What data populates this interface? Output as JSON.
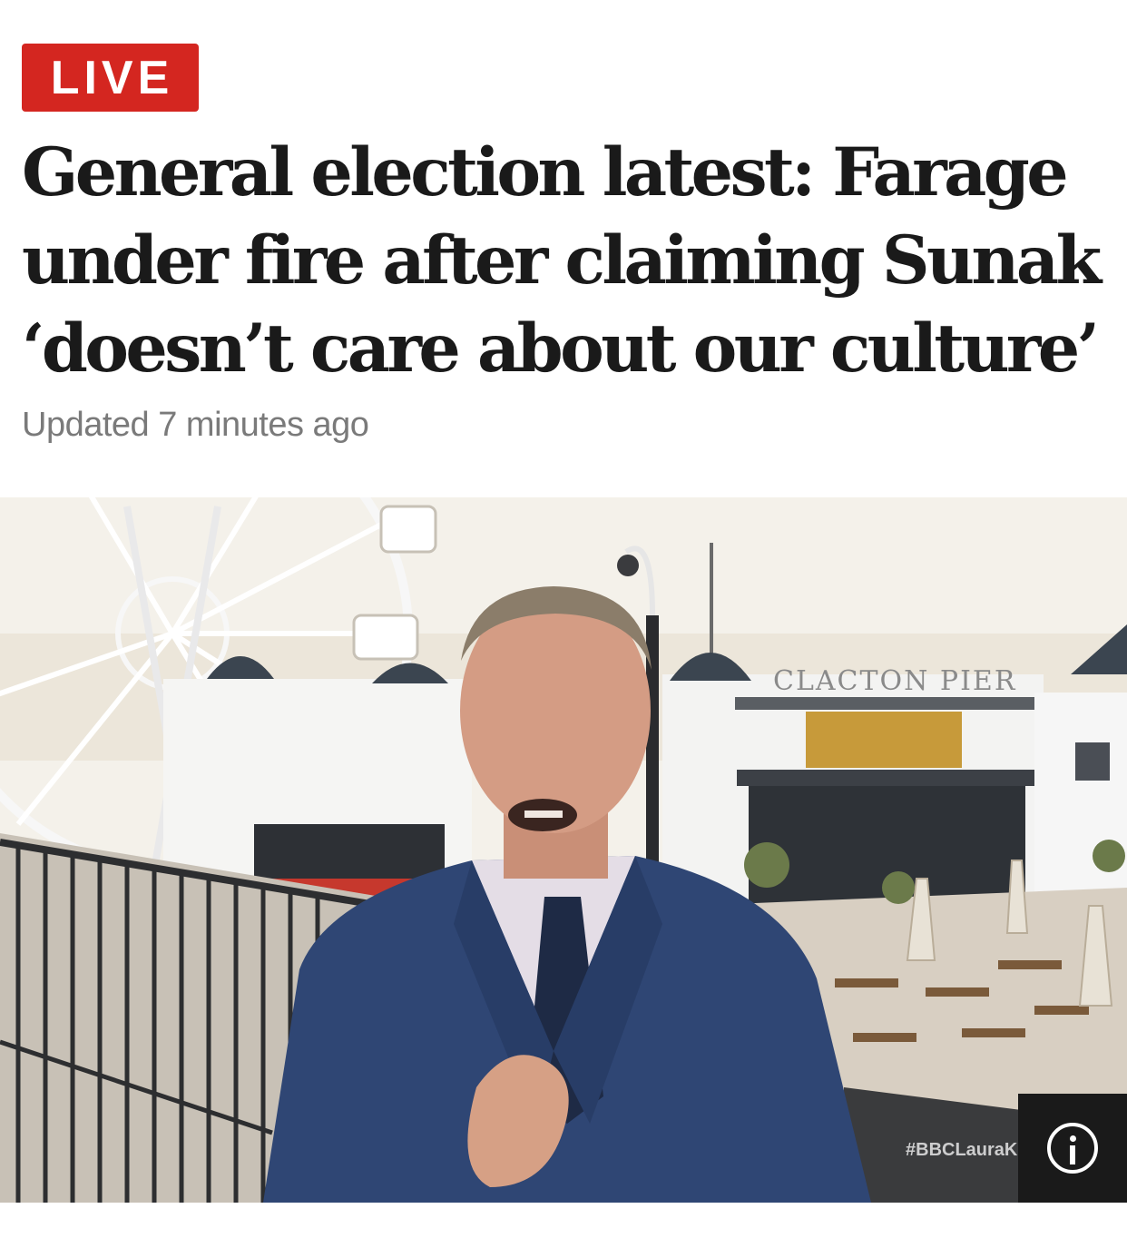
{
  "badge": {
    "label": "LIVE",
    "color": "#d42620"
  },
  "article": {
    "headline": "General election latest: Farage\nunder fire after claiming Sunak\n‘doesn’t care about our culture’",
    "updated": "Updated 7 minutes ago"
  },
  "hero_image": {
    "sign_text": "CLACTON PIER",
    "watermark": "#BBCLauraK"
  },
  "info_button": {
    "icon": "info-icon"
  }
}
